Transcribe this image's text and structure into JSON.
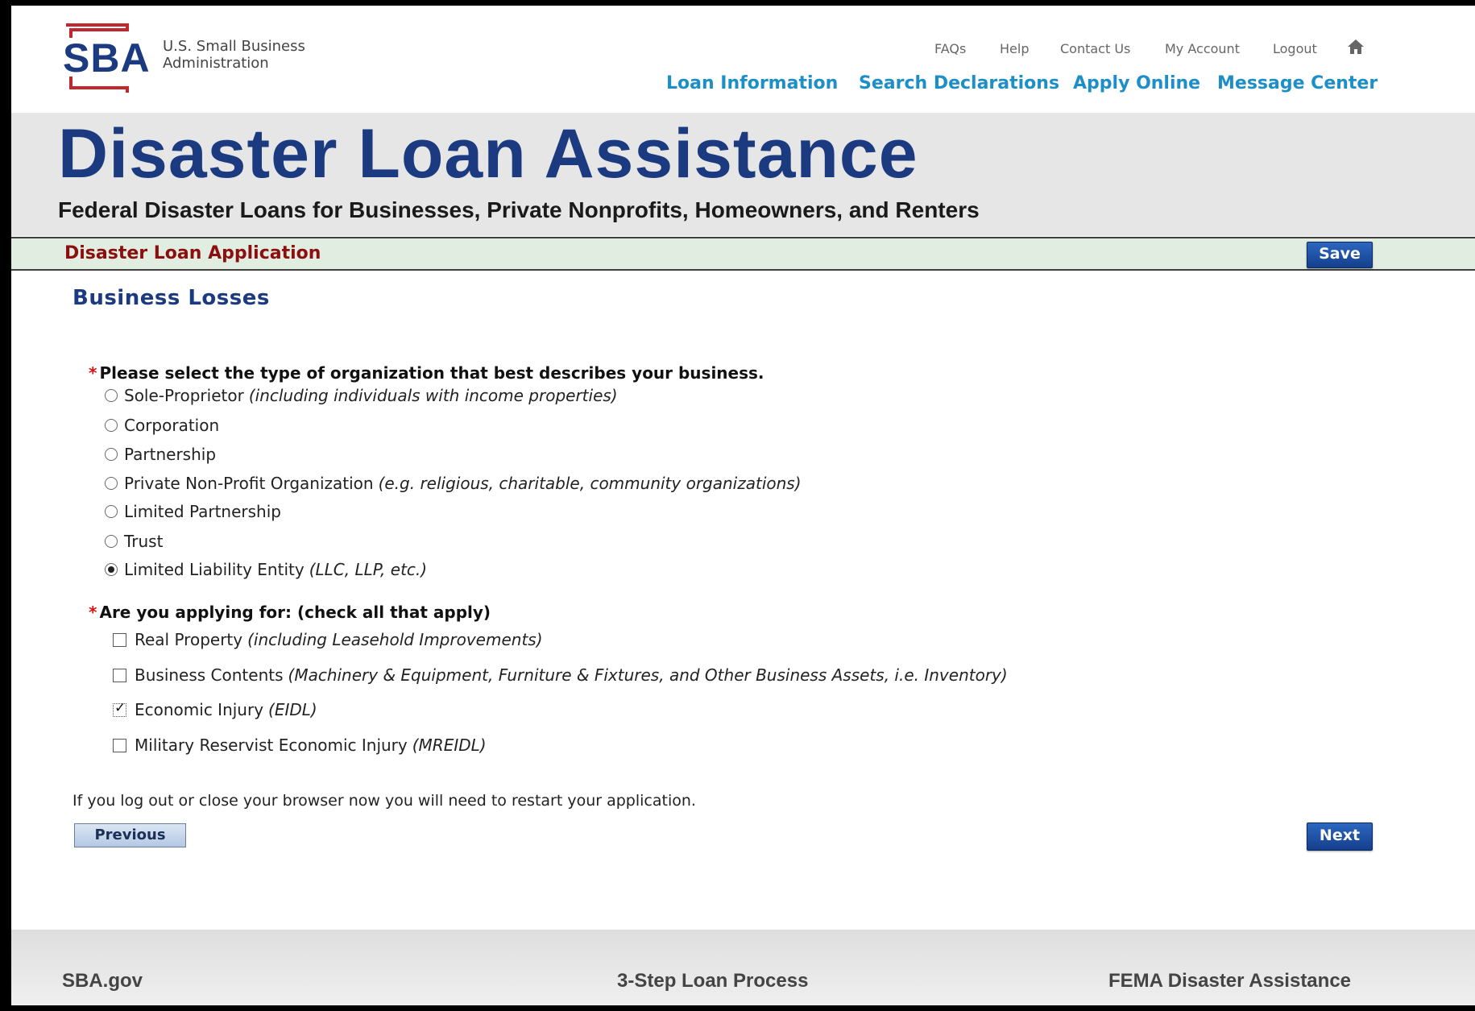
{
  "header": {
    "logo_lettering": "SBA",
    "logo_line1": "U.S. Small Business",
    "logo_line2": "Administration",
    "utility_links": [
      "FAQs",
      "Help",
      "Contact Us",
      "My Account",
      "Logout"
    ],
    "home_icon": "home-icon",
    "main_nav": [
      "Loan Information",
      "Search Declarations",
      "Apply Online",
      "Message Center"
    ]
  },
  "banner": {
    "title": "Disaster Loan Assistance",
    "subtitle": "Federal Disaster Loans for Businesses, Private Nonprofits, Homeowners, and Renters"
  },
  "app_bar": {
    "title": "Disaster Loan Application",
    "save_label": "Save"
  },
  "form": {
    "section_title": "Business Losses",
    "required_marker": "*",
    "org_question": "Please select the type of organization that best describes your business.",
    "org_options": [
      {
        "label": "Sole-Proprietor",
        "hint": "(including individuals with income properties)",
        "selected": false
      },
      {
        "label": "Corporation",
        "hint": "",
        "selected": false
      },
      {
        "label": "Partnership",
        "hint": "",
        "selected": false
      },
      {
        "label": "Private Non-Profit Organization",
        "hint": "(e.g. religious, charitable, community organizations)",
        "selected": false
      },
      {
        "label": "Limited Partnership",
        "hint": "",
        "selected": false
      },
      {
        "label": "Trust",
        "hint": "",
        "selected": false
      },
      {
        "label": "Limited Liability Entity",
        "hint": "(LLC, LLP, etc.)",
        "selected": true
      }
    ],
    "apply_question": "Are you applying for: (check all that apply)",
    "apply_options": [
      {
        "label": "Real Property",
        "hint": "(including Leasehold Improvements)",
        "checked": false
      },
      {
        "label": "Business Contents",
        "hint": "(Machinery & Equipment, Furniture & Fixtures, and Other Business Assets, i.e. Inventory)",
        "checked": false
      },
      {
        "label": "Economic Injury",
        "hint": "(EIDL)",
        "checked": true
      },
      {
        "label": "Military Reservist Economic Injury",
        "hint": "(MREIDL)",
        "checked": false
      }
    ],
    "warning": "If you log out or close your browser now you will need to restart your application.",
    "previous_label": "Previous",
    "next_label": "Next"
  },
  "footer": {
    "links": [
      "SBA.gov",
      "3-Step Loan Process",
      "FEMA Disaster Assistance"
    ]
  },
  "colors": {
    "brand_navy": "#1b3a80",
    "nav_link_blue": "#1c8fc9",
    "app_title_red": "#8b0f0f",
    "appbar_green": "#e2ede1",
    "logo_red": "#c2272d"
  }
}
